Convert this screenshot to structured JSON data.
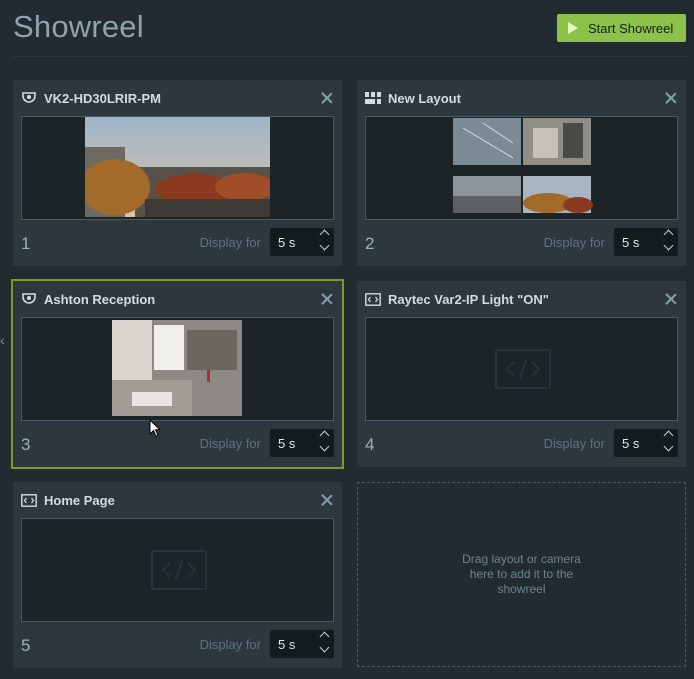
{
  "page": {
    "title": "Showreel",
    "start_button": "Start Showreel"
  },
  "cards": [
    {
      "index": "1",
      "name": "VK2-HD30LRIR-PM",
      "icon": "camera-icon",
      "display_label": "Display for",
      "duration": "5 s"
    },
    {
      "index": "2",
      "name": "New Layout",
      "icon": "layout-icon",
      "display_label": "Display for",
      "duration": "5 s"
    },
    {
      "index": "3",
      "name": "Ashton Reception",
      "icon": "camera-icon",
      "display_label": "Display for",
      "duration": "5 s",
      "selected": true
    },
    {
      "index": "4",
      "name": "Raytec Var2-IP Light \"ON\"",
      "icon": "webpage-icon",
      "display_label": "Display for",
      "duration": "5 s"
    },
    {
      "index": "5",
      "name": "Home Page",
      "icon": "webpage-icon",
      "display_label": "Display for",
      "duration": "5 s"
    }
  ],
  "dropzone": {
    "text": "Drag layout or camera here to add it to the showreel"
  },
  "colors": {
    "accent": "#8bc34a",
    "selected_border": "#7e9a25",
    "background": "#212b30",
    "card": "#2c373e"
  }
}
